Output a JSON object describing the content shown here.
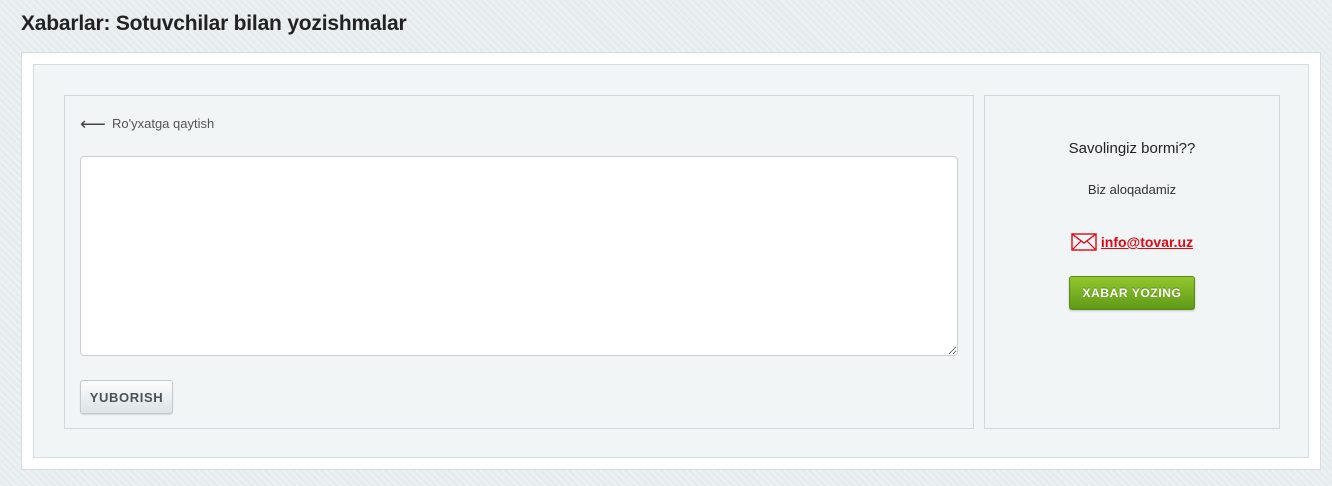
{
  "page": {
    "title": "Xabarlar: Sotuvchilar bilan yozishmalar"
  },
  "conversation": {
    "back_link_label": "Ro'yxatga qaytish",
    "message_value": "",
    "send_label": "YUBORISH"
  },
  "support": {
    "question": "Savolingiz bormi??",
    "contact_text": "Biz aloqadamiz",
    "email": "info@tovar.uz",
    "write_label": "XABAR YOZING"
  },
  "icons": {
    "back": "arrow-left-icon",
    "mail": "envelope-icon"
  },
  "colors": {
    "email_link": "#e30613",
    "write_button": "#6fa61c",
    "background": "#e6ecee"
  }
}
